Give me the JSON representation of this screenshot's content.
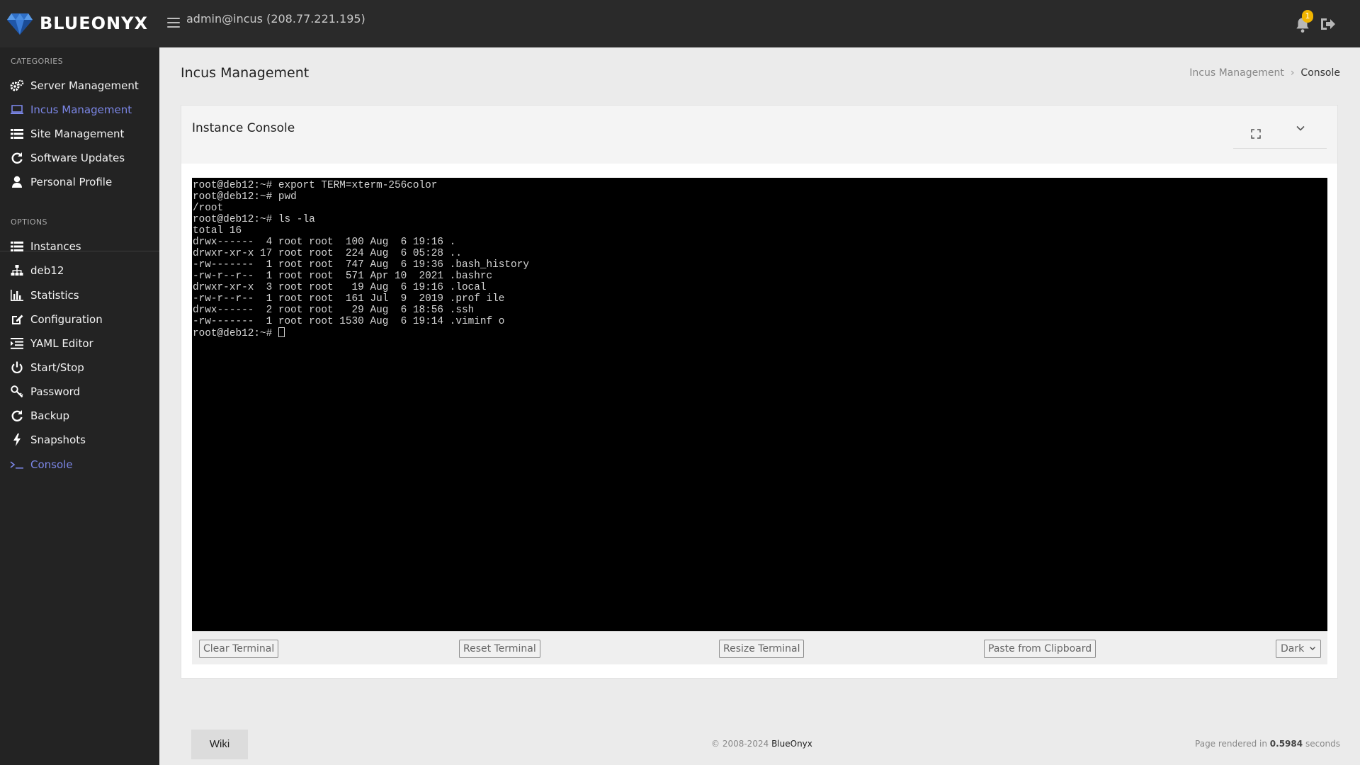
{
  "header": {
    "brand": "BLUEONYX",
    "user_host": "admin@incus (208.77.221.195)",
    "notification_count": "1",
    "colors": {
      "bar": "#2a2a2a",
      "badge": "#f0b400",
      "logo": "#3a7bd5"
    }
  },
  "sidebar": {
    "categories_label": "CATEGORIES",
    "categories": [
      {
        "label": "Server Management",
        "icon": "gears-icon"
      },
      {
        "label": "Incus Management",
        "icon": "laptop-icon",
        "active": true
      },
      {
        "label": "Site Management",
        "icon": "list-icon"
      },
      {
        "label": "Software Updates",
        "icon": "refresh-icon"
      },
      {
        "label": "Personal Profile",
        "icon": "user-icon"
      }
    ],
    "options_label": "OPTIONS",
    "options": [
      {
        "label": "Instances",
        "icon": "list-icon"
      },
      {
        "label": "deb12",
        "icon": "sitemap-icon"
      },
      {
        "label": "Statistics",
        "icon": "bar-chart-icon"
      },
      {
        "label": "Configuration",
        "icon": "edit-icon"
      },
      {
        "label": "YAML Editor",
        "icon": "list-indent-icon"
      },
      {
        "label": "Start/Stop",
        "icon": "power-icon"
      },
      {
        "label": "Password",
        "icon": "key-icon"
      },
      {
        "label": "Backup",
        "icon": "refresh-icon"
      },
      {
        "label": "Snapshots",
        "icon": "bolt-icon"
      },
      {
        "label": "Console",
        "icon": "terminal-icon",
        "active": true
      }
    ],
    "colors": {
      "background": "#232323",
      "active": "#7b86e6"
    }
  },
  "page": {
    "title": "Incus Management",
    "breadcrumb": {
      "parent": "Incus Management",
      "separator": "›",
      "current": "Console"
    }
  },
  "card": {
    "title": "Instance Console"
  },
  "terminal": {
    "lines": [
      "root@deb12:~# export TERM=xterm-256color",
      "root@deb12:~# pwd",
      "/root",
      "root@deb12:~# ls -la",
      "total 16",
      "drwx------  4 root root  100 Aug  6 19:16 .",
      "drwxr-xr-x 17 root root  224 Aug  6 05:28 ..",
      "-rw-------  1 root root  747 Aug  6 19:36 .bash_history",
      "-rw-r--r--  1 root root  571 Apr 10  2021 .bashrc",
      "drwxr-xr-x  3 root root   19 Aug  6 19:16 .local",
      "-rw-r--r--  1 root root  161 Jul  9  2019 .prof ile",
      "drwx------  2 root root   29 Aug  6 18:56 .ssh",
      "-rw-------  1 root root 1530 Aug  6 19:14 .viminf o"
    ],
    "prompt": "root@deb12:~# ",
    "colors": {
      "background": "#000000",
      "foreground": "#d4d4d4"
    }
  },
  "terminal_controls": {
    "clear": "Clear Terminal",
    "reset": "Reset Terminal",
    "resize": "Resize Terminal",
    "paste": "Paste from Clipboard",
    "theme_selected": "Dark"
  },
  "footer": {
    "wiki": "Wiki",
    "copyright_prefix": "© 2008-2024",
    "copyright_brand": "BlueOnyx",
    "rendered_prefix": "Page rendered in",
    "rendered_time": "0.5984",
    "rendered_suffix": "seconds"
  }
}
